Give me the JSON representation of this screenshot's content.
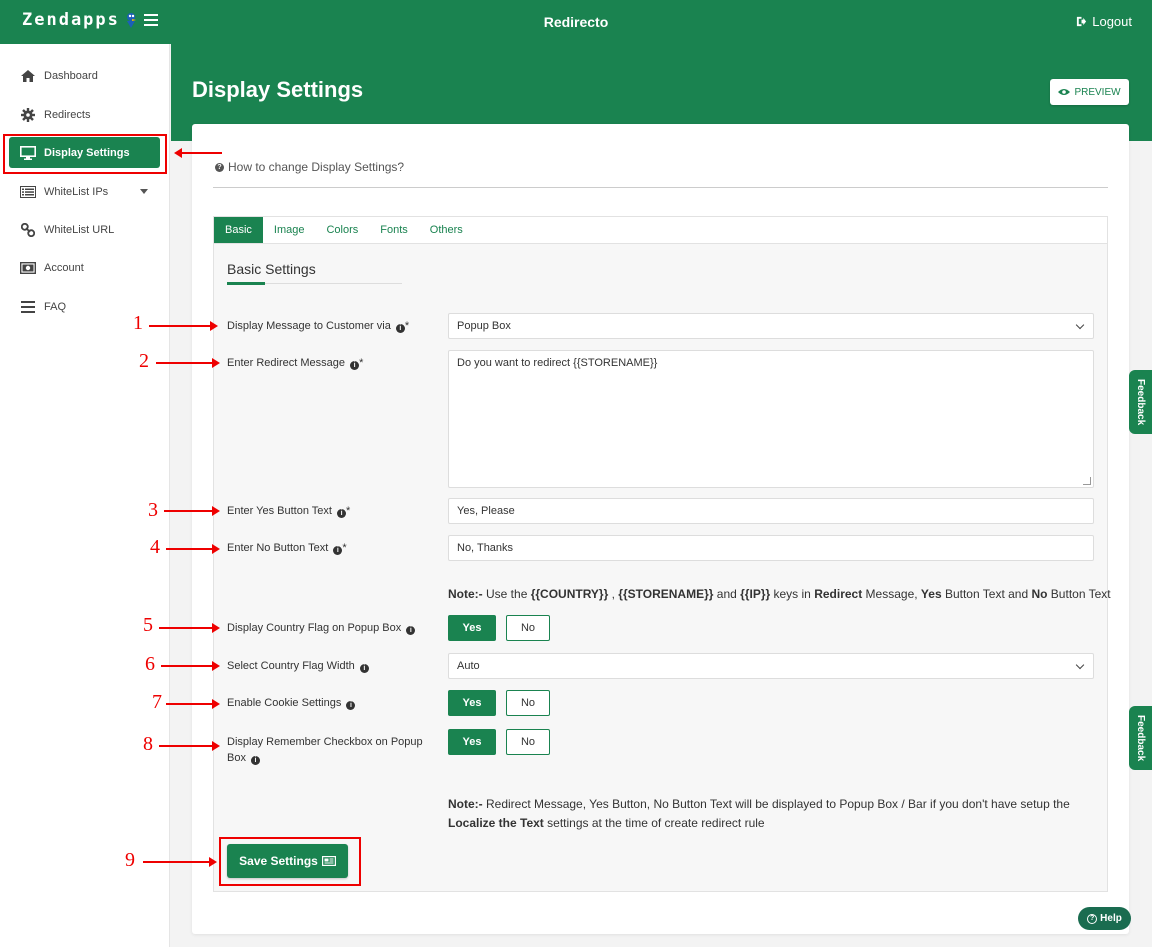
{
  "header": {
    "logo": "Zendapps",
    "app_title": "Redirecto",
    "logout_label": "Logout"
  },
  "sidebar": {
    "items": [
      {
        "label": "Dashboard",
        "icon": "home-icon"
      },
      {
        "label": "Redirects",
        "icon": "gear-icon"
      },
      {
        "label": "Display Settings",
        "icon": "monitor-icon"
      },
      {
        "label": "WhiteList IPs",
        "icon": "list-icon"
      },
      {
        "label": "WhiteList URL",
        "icon": "link-icon"
      },
      {
        "label": "Account",
        "icon": "money-icon"
      },
      {
        "label": "FAQ",
        "icon": "bars-icon"
      }
    ]
  },
  "page": {
    "title": "Display Settings",
    "preview_label": "PREVIEW",
    "howto": "How to change Display Settings?"
  },
  "tabs": [
    "Basic",
    "Image",
    "Colors",
    "Fonts",
    "Others"
  ],
  "section_title": "Basic Settings",
  "form": {
    "display_via": {
      "label": "Display Message to Customer via",
      "value": "Popup Box"
    },
    "redirect_message": {
      "label": "Enter Redirect Message",
      "value": "Do you want to redirect {{STORENAME}}"
    },
    "yes_text": {
      "label": "Enter Yes Button Text",
      "value": "Yes, Please"
    },
    "no_text": {
      "label": "Enter No Button Text",
      "value": "No, Thanks"
    },
    "flag": {
      "label": "Display Country Flag on Popup Box",
      "selected": "Yes"
    },
    "flag_width": {
      "label": "Select Country Flag Width",
      "value": "Auto"
    },
    "cookie": {
      "label": "Enable Cookie Settings",
      "selected": "Yes"
    },
    "remember": {
      "label_line1": "Display Remember Checkbox on Popup",
      "label_line2": "Box",
      "selected": "Yes"
    },
    "yes_label": "Yes",
    "no_label": "No",
    "save_label": "Save Settings"
  },
  "notes": {
    "note1": {
      "prefix": "Note:-",
      "t1": " Use the ",
      "k1": "{{COUNTRY}}",
      "t2": " , ",
      "k2": "{{STORENAME}}",
      "t3": " and ",
      "k3": "{{IP}}",
      "t4": " keys in ",
      "k4": "Redirect",
      "t5": " Message, ",
      "k5": "Yes",
      "t6": " Button Text and ",
      "k6": "No",
      "t7": " Button Text"
    },
    "note2": {
      "prefix": "Note:-",
      "t1": " Redirect Message, Yes Button, No Button Text will be displayed to Popup Box / Bar if you don't have setup the",
      "k1": "Localize the Text",
      "t2": " settings at the time of create redirect rule"
    }
  },
  "annotations": [
    "1",
    "2",
    "3",
    "4",
    "5",
    "6",
    "7",
    "8",
    "9"
  ],
  "widgets": {
    "feedback_label": "Feedback",
    "help_label": "Help"
  },
  "colors": {
    "primary": "#1a8350",
    "annotation": "#ee0000",
    "panel": "#f7f7f7"
  }
}
